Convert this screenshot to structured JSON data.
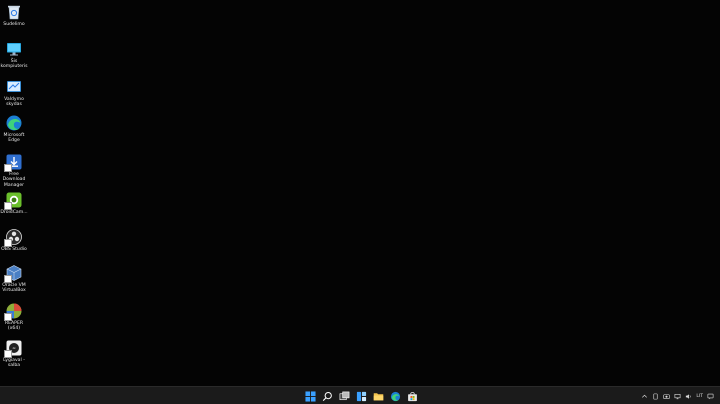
{
  "desktop": {
    "icons": [
      {
        "label": "Sudelimo",
        "icon": "recycle-bin-icon"
      },
      {
        "label": "Šis\nkompiuteris",
        "icon": "this-pc-icon"
      },
      {
        "label": "Valdymo\nskydas",
        "icon": "control-panel-icon"
      },
      {
        "label": "Microsoft\nEdge",
        "icon": "edge-icon"
      },
      {
        "label": "Free\nDownload\nManager",
        "icon": "free-download-manager-icon"
      },
      {
        "label": "DroidCam...",
        "icon": "droidcam-icon"
      },
      {
        "label": "OBS Studio",
        "icon": "obs-studio-icon"
      },
      {
        "label": "Oracle VM\nVirtualBox",
        "icon": "virtualbox-icon"
      },
      {
        "label": "REAPER (x64)",
        "icon": "reaper-icon"
      },
      {
        "label": "Lygiaval -\nsalba",
        "icon": "app-shortcut-icon"
      }
    ]
  },
  "taskbar": {
    "pinned": [
      "start-icon",
      "search-icon",
      "task-view-icon",
      "widgets-icon",
      "file-explorer-icon",
      "edge-icon",
      "store-icon"
    ],
    "tray": {
      "language": "LIT"
    }
  }
}
